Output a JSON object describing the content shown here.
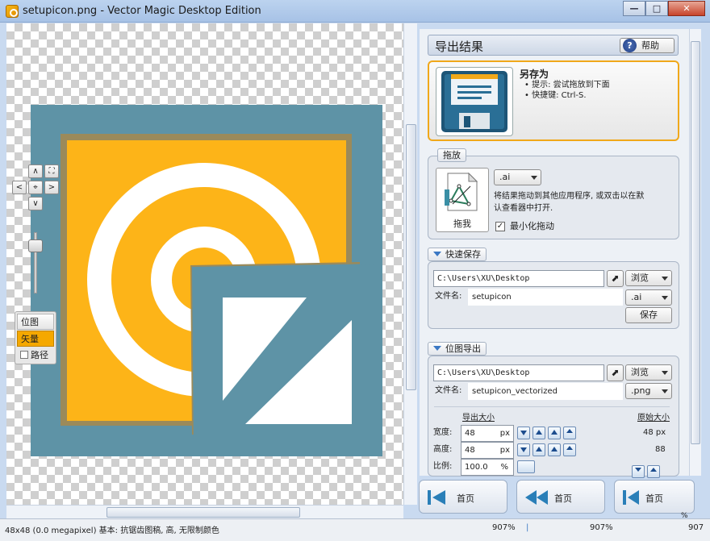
{
  "window": {
    "title": "setupicon.png - Vector Magic Desktop Edition",
    "minimize": "—",
    "maximize": "□",
    "close": "✕"
  },
  "canvas_tools": {
    "up": "∧",
    "down": "∨",
    "left": "<",
    "right": ">",
    "fit": "⛶",
    "center": "⌖",
    "view_options": [
      {
        "label": "位图",
        "active": false
      },
      {
        "label": "矢量",
        "active": true
      },
      {
        "label": "路径",
        "active": false
      }
    ]
  },
  "colors": {
    "image_bg": "#5e93a6",
    "image_orange": "#fdb418",
    "image_white": "#ffffff",
    "accent_border": "#f0a81a",
    "link_blue": "#3b78c4"
  },
  "panel": {
    "header_title": "导出结果",
    "help_label": "帮助",
    "save_as": {
      "title": "另存为",
      "tips": [
        "提示: 尝试拖放到下面",
        "快捷键: Ctrl-S."
      ]
    },
    "drag": {
      "tab_label": "拖放",
      "card_label": "拖我",
      "format": ".ai",
      "description_line1": "将结果拖动到其他应用程序, 或双击以在默",
      "description_line2": "认查看器中打开.",
      "minimize_label": "最小化拖动",
      "minimize_checked": "✓"
    },
    "quick_save": {
      "tab_label": "快速保存",
      "path": "C:\\Users\\XU\\Desktop",
      "browse_label": "浏览",
      "filename_label": "文件名:",
      "filename": "setupicon",
      "format": ".ai",
      "save_label": "保存"
    },
    "bitmap_export": {
      "tab_label": "位图导出",
      "path": "C:\\Users\\XU\\Desktop",
      "browse_label": "浏览",
      "filename_label": "文件名:",
      "filename": "setupicon_vectorized",
      "format": ".png",
      "export_size_label": "导出大小",
      "original_size_label": "原始大小",
      "width_label": "宽度:",
      "width_value": "48",
      "width_unit": "px",
      "height_label": "高度:",
      "height_value": "48",
      "height_unit": "px",
      "scale_label": "比例:",
      "scale_value": "100.0",
      "scale_unit": "%",
      "original_width": "48 px",
      "original_height": "88"
    }
  },
  "bottom_nav": [
    {
      "label": "首页"
    },
    {
      "label": "首页"
    },
    {
      "label": "首页"
    }
  ],
  "status": {
    "info": "48x48 (0.0 megapixel)  基本: 抗锯齿图稿, 高, 无限制颜色",
    "zoom_left": "907%",
    "zoom_mid": "907%",
    "zoom_right": "907",
    "percent_mark": "%"
  }
}
